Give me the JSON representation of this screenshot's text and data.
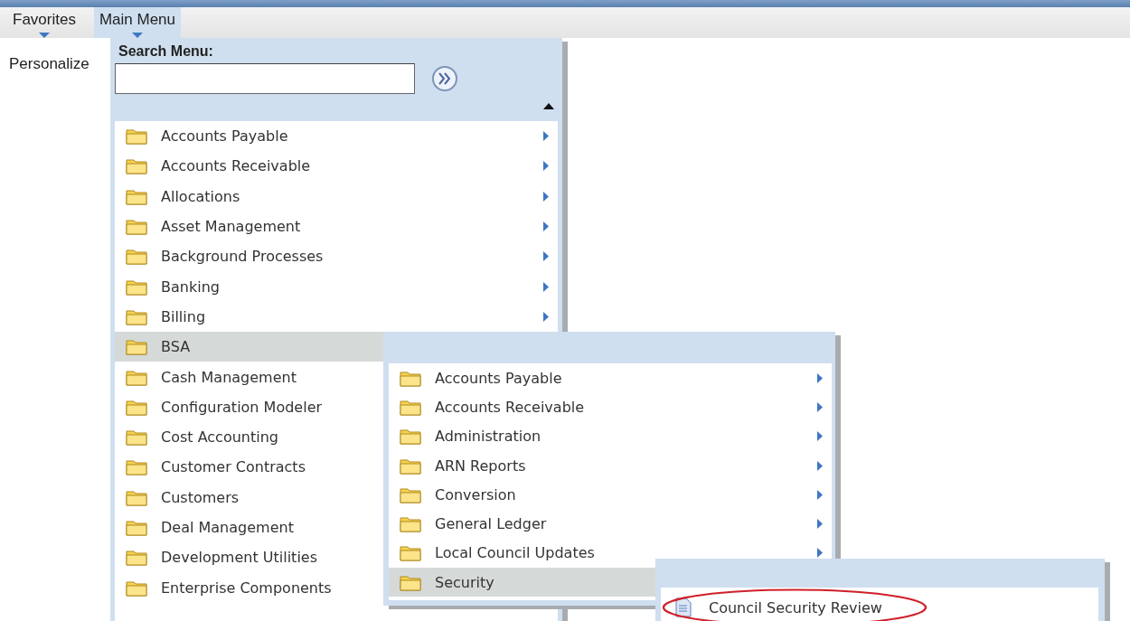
{
  "nav": [
    {
      "label": "Favorites",
      "selected": false
    },
    {
      "label": "Main Menu",
      "selected": true
    }
  ],
  "page_text": "Personalize",
  "main_menu": {
    "search_label": "Search Menu:",
    "items": [
      {
        "label": "Accounts Payable",
        "kind": "folder",
        "selected": false,
        "expandable": true
      },
      {
        "label": "Accounts Receivable",
        "kind": "folder",
        "selected": false,
        "expandable": true
      },
      {
        "label": "Allocations",
        "kind": "folder",
        "selected": false,
        "expandable": true
      },
      {
        "label": "Asset Management",
        "kind": "folder",
        "selected": false,
        "expandable": true
      },
      {
        "label": "Background Processes",
        "kind": "folder",
        "selected": false,
        "expandable": true
      },
      {
        "label": "Banking",
        "kind": "folder",
        "selected": false,
        "expandable": true
      },
      {
        "label": "Billing",
        "kind": "folder",
        "selected": false,
        "expandable": true
      },
      {
        "label": "BSA",
        "kind": "folder",
        "selected": true
      },
      {
        "label": "Cash Management",
        "kind": "folder",
        "selected": false
      },
      {
        "label": "Configuration Modeler",
        "kind": "folder",
        "selected": false
      },
      {
        "label": "Cost Accounting",
        "kind": "folder",
        "selected": false
      },
      {
        "label": "Customer Contracts",
        "kind": "folder",
        "selected": false
      },
      {
        "label": "Customers",
        "kind": "folder",
        "selected": false
      },
      {
        "label": "Deal Management",
        "kind": "folder",
        "selected": false
      },
      {
        "label": "Development Utilities",
        "kind": "folder",
        "selected": false
      },
      {
        "label": "Enterprise Components",
        "kind": "folder",
        "selected": false
      }
    ]
  },
  "submenu": {
    "items": [
      {
        "label": "Accounts Payable",
        "kind": "folder",
        "selected": false,
        "expandable": true
      },
      {
        "label": "Accounts Receivable",
        "kind": "folder",
        "selected": false,
        "expandable": true
      },
      {
        "label": "Administration",
        "kind": "folder",
        "selected": false,
        "expandable": true
      },
      {
        "label": "ARN Reports",
        "kind": "folder",
        "selected": false,
        "expandable": true
      },
      {
        "label": "Conversion",
        "kind": "folder",
        "selected": false,
        "expandable": true
      },
      {
        "label": "General Ledger",
        "kind": "folder",
        "selected": false,
        "expandable": true
      },
      {
        "label": "Local Council Updates",
        "kind": "folder",
        "selected": false,
        "expandable": true
      },
      {
        "label": "Security",
        "kind": "folder",
        "selected": true
      }
    ]
  },
  "submenu_2": {
    "items": [
      {
        "label": "Council Security Review",
        "kind": "page",
        "selected": false,
        "circled": true
      }
    ]
  }
}
